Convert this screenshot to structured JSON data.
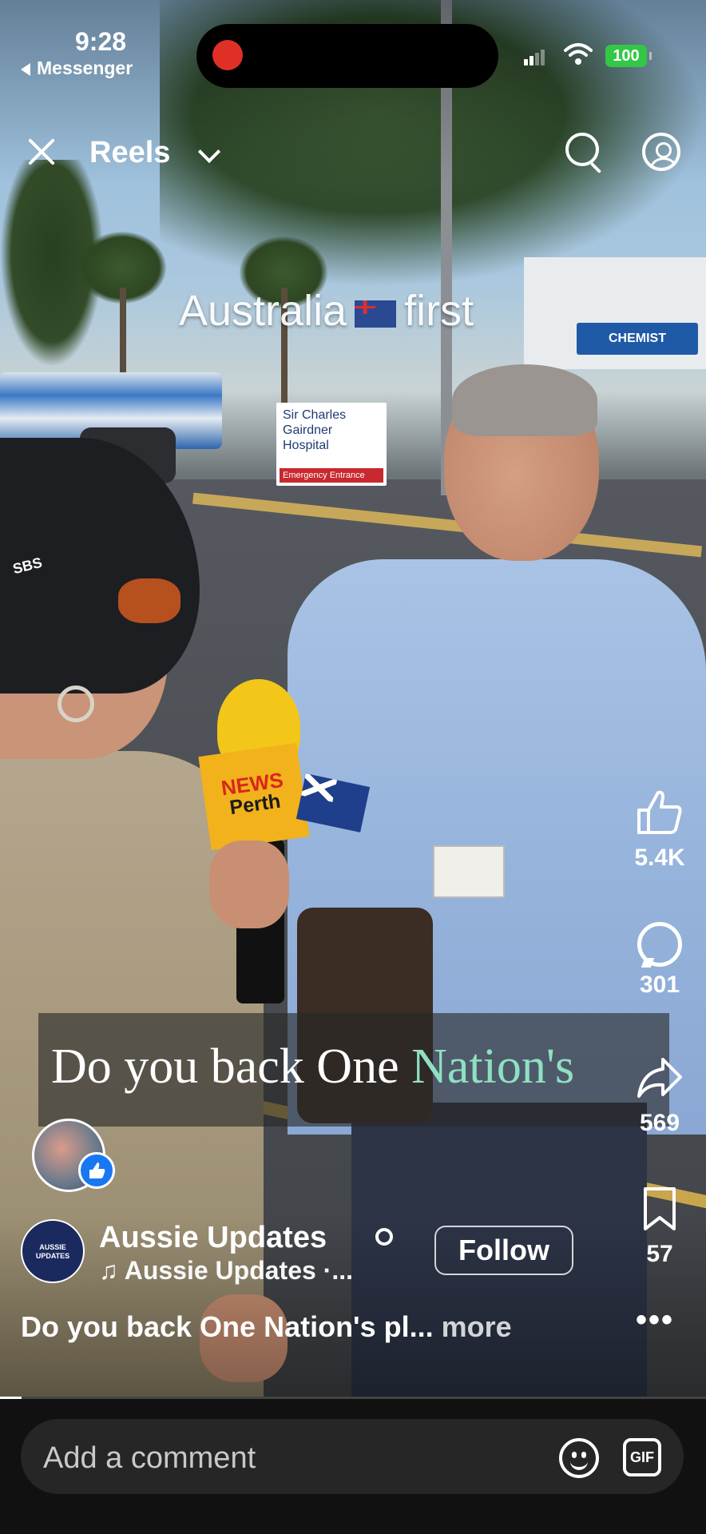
{
  "status_bar": {
    "time": "9:28",
    "back_app": "Messenger",
    "battery": "100"
  },
  "header": {
    "title": "Reels"
  },
  "video": {
    "overlay_text_left": "Australia",
    "overlay_text_right": "first",
    "subtitle_plain": "Do you back One ",
    "subtitle_highlight": "Nation's",
    "sign_text": "Sir Charles Gairdner Hospital",
    "sign_subtext": "Emergency Entrance",
    "chemist_text": "CHEMIST",
    "mic_brand": "NEWS",
    "mic_city": "Perth",
    "hat_text": "SBS"
  },
  "actions": {
    "likes": "5.4K",
    "comments": "301",
    "shares": "569",
    "saves": "57"
  },
  "channel": {
    "avatar_text": "AUSSIE UPDATES",
    "name": "Aussie Updates",
    "audio": "♫ Aussie Updates ·...",
    "follow_label": "Follow"
  },
  "caption": {
    "text": "Do you back One Nation's pl...",
    "more": "more"
  },
  "playback": {
    "progress": 0.03
  },
  "comment_bar": {
    "placeholder": "Add a comment",
    "gif_label": "GIF"
  },
  "colors": {
    "battery_green": "#33c748",
    "subtitle_highlight": "#8fe0c3",
    "recording_red": "#e03026"
  }
}
